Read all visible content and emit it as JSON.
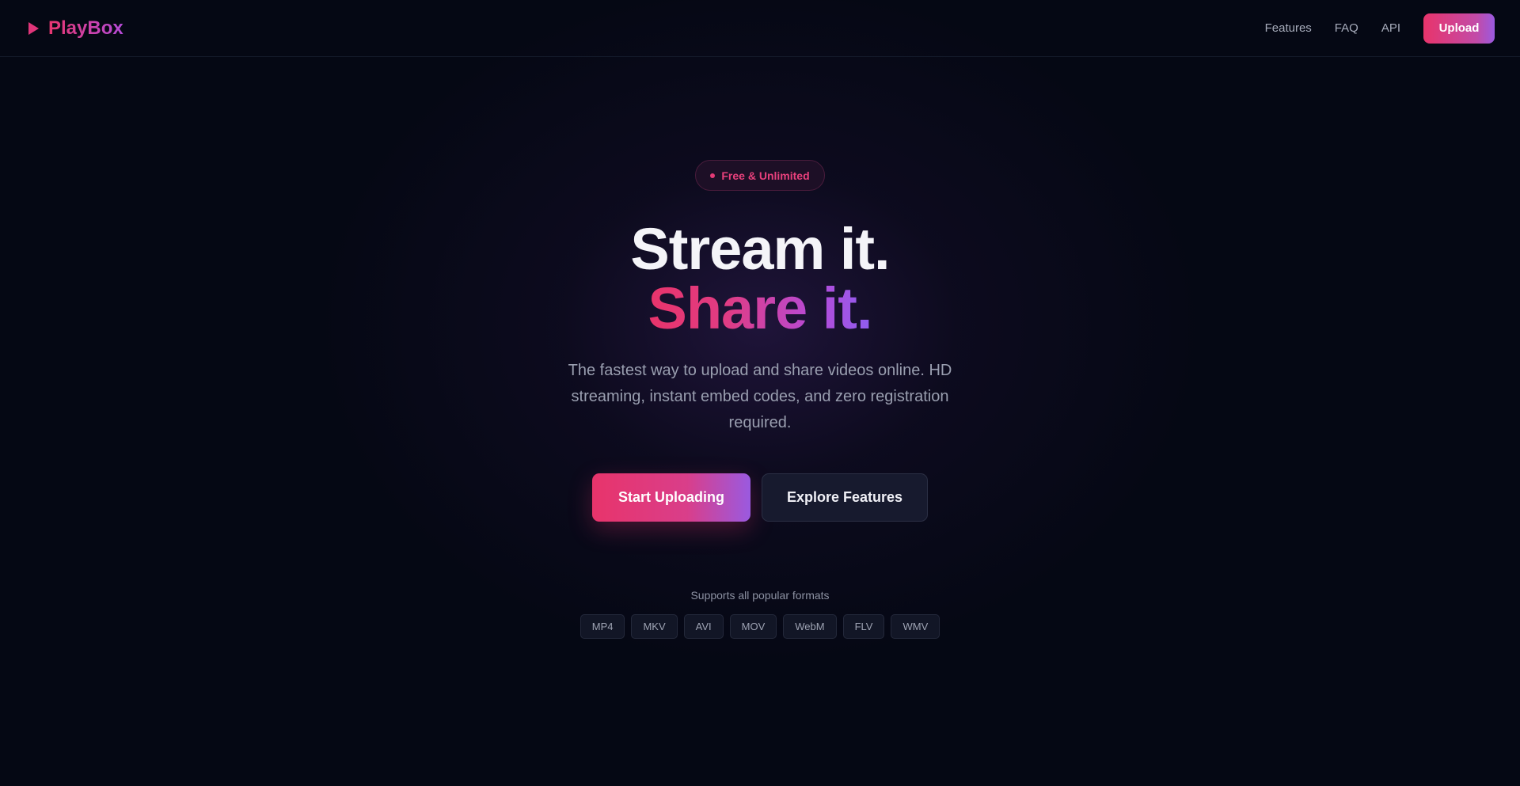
{
  "header": {
    "logo_text": "PlayBox",
    "logo_icon": "play-icon",
    "nav": [
      {
        "label": "Features"
      },
      {
        "label": "FAQ"
      },
      {
        "label": "API"
      }
    ],
    "upload_label": "Upload"
  },
  "hero": {
    "badge": "Free & Unlimited",
    "title_line1": "Stream it.",
    "title_line2": "Share it.",
    "subtitle": "The fastest way to upload and share videos online. HD streaming, instant embed codes, and zero registration required.",
    "primary_cta": "Start Uploading",
    "secondary_cta": "Explore Features"
  },
  "formats": {
    "label": "Supports all popular formats",
    "items": [
      "MP4",
      "MKV",
      "AVI",
      "MOV",
      "WebM",
      "FLV",
      "WMV"
    ]
  },
  "colors": {
    "background": "#050814",
    "accent_pink": "#e8346b",
    "accent_purple": "#9a5ae0"
  }
}
